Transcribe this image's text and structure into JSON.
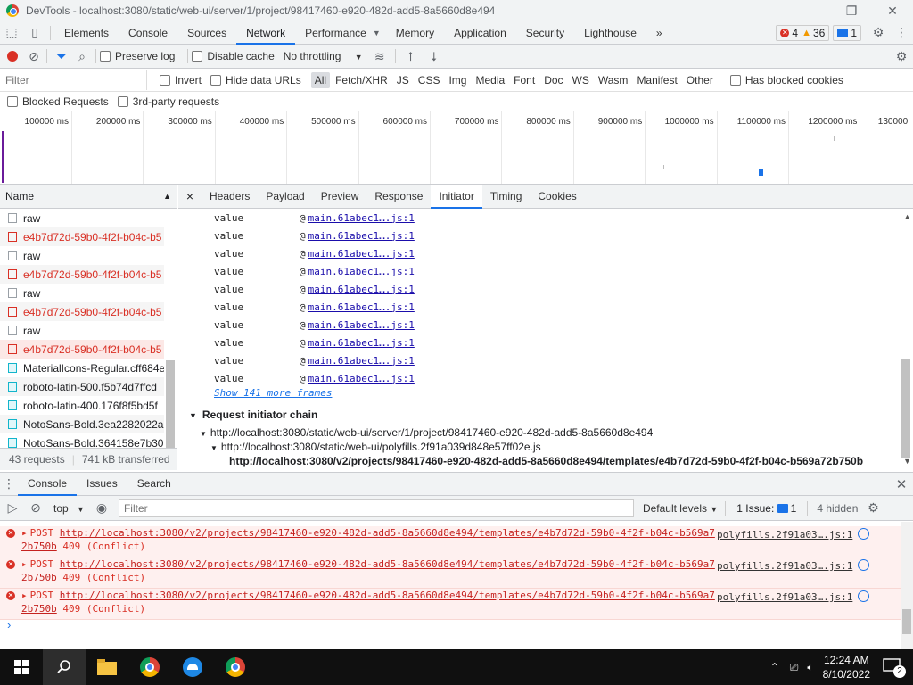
{
  "window": {
    "title": "DevTools - localhost:3080/static/web-ui/server/1/project/98417460-e920-482d-add5-8a5660d8e494"
  },
  "panel_tabs": [
    "Elements",
    "Console",
    "Sources",
    "Network",
    "Performance",
    "Memory",
    "Application",
    "Security",
    "Lighthouse"
  ],
  "active_panel": "Network",
  "more_tabs": "»",
  "badges": {
    "errors": "4",
    "warnings": "36",
    "messages": "1"
  },
  "toolbar": {
    "preserve_log": "Preserve log",
    "disable_cache": "Disable cache",
    "throttling": "No throttling"
  },
  "filter": {
    "placeholder": "Filter",
    "invert": "Invert",
    "hide_data_urls": "Hide data URLs",
    "types": [
      "All",
      "Fetch/XHR",
      "JS",
      "CSS",
      "Img",
      "Media",
      "Font",
      "Doc",
      "WS",
      "Wasm",
      "Manifest",
      "Other"
    ],
    "has_blocked_cookies": "Has blocked cookies",
    "blocked_requests": "Blocked Requests",
    "third_party": "3rd-party requests"
  },
  "overview": {
    "ticks": [
      "100000 ms",
      "200000 ms",
      "300000 ms",
      "400000 ms",
      "500000 ms",
      "600000 ms",
      "700000 ms",
      "800000 ms",
      "900000 ms",
      "1000000 ms",
      "1100000 ms",
      "1200000 ms",
      "130000"
    ]
  },
  "request_list": {
    "column": "Name",
    "rows": [
      {
        "name": "raw",
        "kind": "doc"
      },
      {
        "name": "e4b7d72d-59b0-4f2f-b04c-b5",
        "kind": "error"
      },
      {
        "name": "raw",
        "kind": "doc"
      },
      {
        "name": "e4b7d72d-59b0-4f2f-b04c-b5",
        "kind": "error"
      },
      {
        "name": "raw",
        "kind": "doc"
      },
      {
        "name": "e4b7d72d-59b0-4f2f-b04c-b5",
        "kind": "error"
      },
      {
        "name": "raw",
        "kind": "doc"
      },
      {
        "name": "e4b7d72d-59b0-4f2f-b04c-b5",
        "kind": "error-selected"
      },
      {
        "name": "MaterialIcons-Regular.cff684e",
        "kind": "font"
      },
      {
        "name": "roboto-latin-500.f5b74d7ffcd",
        "kind": "font"
      },
      {
        "name": "roboto-latin-400.176f8f5bd5f",
        "kind": "font"
      },
      {
        "name": "NotoSans-Bold.3ea2282022a.",
        "kind": "font"
      },
      {
        "name": "NotoSans-Bold.364158e7b30",
        "kind": "font"
      }
    ],
    "summary_requests": "43 requests",
    "summary_transferred": "741 kB transferred"
  },
  "detail": {
    "close": "×",
    "tabs": [
      "Headers",
      "Payload",
      "Preview",
      "Response",
      "Initiator",
      "Timing",
      "Cookies"
    ],
    "active_tab": "Initiator",
    "frames": [
      {
        "fn": "value",
        "at": "@",
        "link": "main.61abec1….js:1"
      },
      {
        "fn": "value",
        "at": "@",
        "link": "main.61abec1….js:1"
      },
      {
        "fn": "value",
        "at": "@",
        "link": "main.61abec1….js:1"
      },
      {
        "fn": "value",
        "at": "@",
        "link": "main.61abec1….js:1"
      },
      {
        "fn": "value",
        "at": "@",
        "link": "main.61abec1….js:1"
      },
      {
        "fn": "value",
        "at": "@",
        "link": "main.61abec1….js:1"
      },
      {
        "fn": "value",
        "at": "@",
        "link": "main.61abec1….js:1"
      },
      {
        "fn": "value",
        "at": "@",
        "link": "main.61abec1….js:1"
      },
      {
        "fn": "value",
        "at": "@",
        "link": "main.61abec1….js:1"
      },
      {
        "fn": "value",
        "at": "@",
        "link": "main.61abec1….js:1"
      }
    ],
    "show_more": "Show 141 more frames",
    "chain_title": "Request initiator chain",
    "chain": [
      "http://localhost:3080/static/web-ui/server/1/project/98417460-e920-482d-add5-8a5660d8e494",
      "http://localhost:3080/static/web-ui/polyfills.2f91a039d848e57ff02e.js",
      "http://localhost:3080/v2/projects/98417460-e920-482d-add5-8a5660d8e494/templates/e4b7d72d-59b0-4f2f-b04c-b569a72b750b"
    ]
  },
  "drawer": {
    "tabs": [
      "Console",
      "Issues",
      "Search"
    ],
    "active_tab": "Console",
    "context": "top",
    "filter_placeholder": "Filter",
    "levels": "Default levels",
    "issues": "1 Issue:",
    "issues_count": "1",
    "hidden": "4 hidden"
  },
  "console_messages": [
    {
      "method": "POST",
      "url_line1": "http://localhost:3080/v2/projects/98417460-e920-482d-add5-8a5660d8e494/templates/e4b7d72d-59b0-4f2f-b04c-b569a7",
      "url_line2": "2b750b",
      "status": "409 (Conflict)",
      "source": "polyfills.2f91a03….js:1"
    },
    {
      "method": "POST",
      "url_line1": "http://localhost:3080/v2/projects/98417460-e920-482d-add5-8a5660d8e494/templates/e4b7d72d-59b0-4f2f-b04c-b569a7",
      "url_line2": "2b750b",
      "status": "409 (Conflict)",
      "source": "polyfills.2f91a03….js:1"
    },
    {
      "method": "POST",
      "url_line1": "http://localhost:3080/v2/projects/98417460-e920-482d-add5-8a5660d8e494/templates/e4b7d72d-59b0-4f2f-b04c-b569a7",
      "url_line2": "2b750b",
      "status": "409 (Conflict)",
      "source": "polyfills.2f91a03….js:1"
    }
  ],
  "prompt": "›",
  "taskbar": {
    "time": "12:24 AM",
    "date": "8/10/2022",
    "notifications": "2"
  },
  "colors": {
    "accent": "#1a73e8",
    "error": "#d93025",
    "error_bg": "#fef0ef"
  }
}
